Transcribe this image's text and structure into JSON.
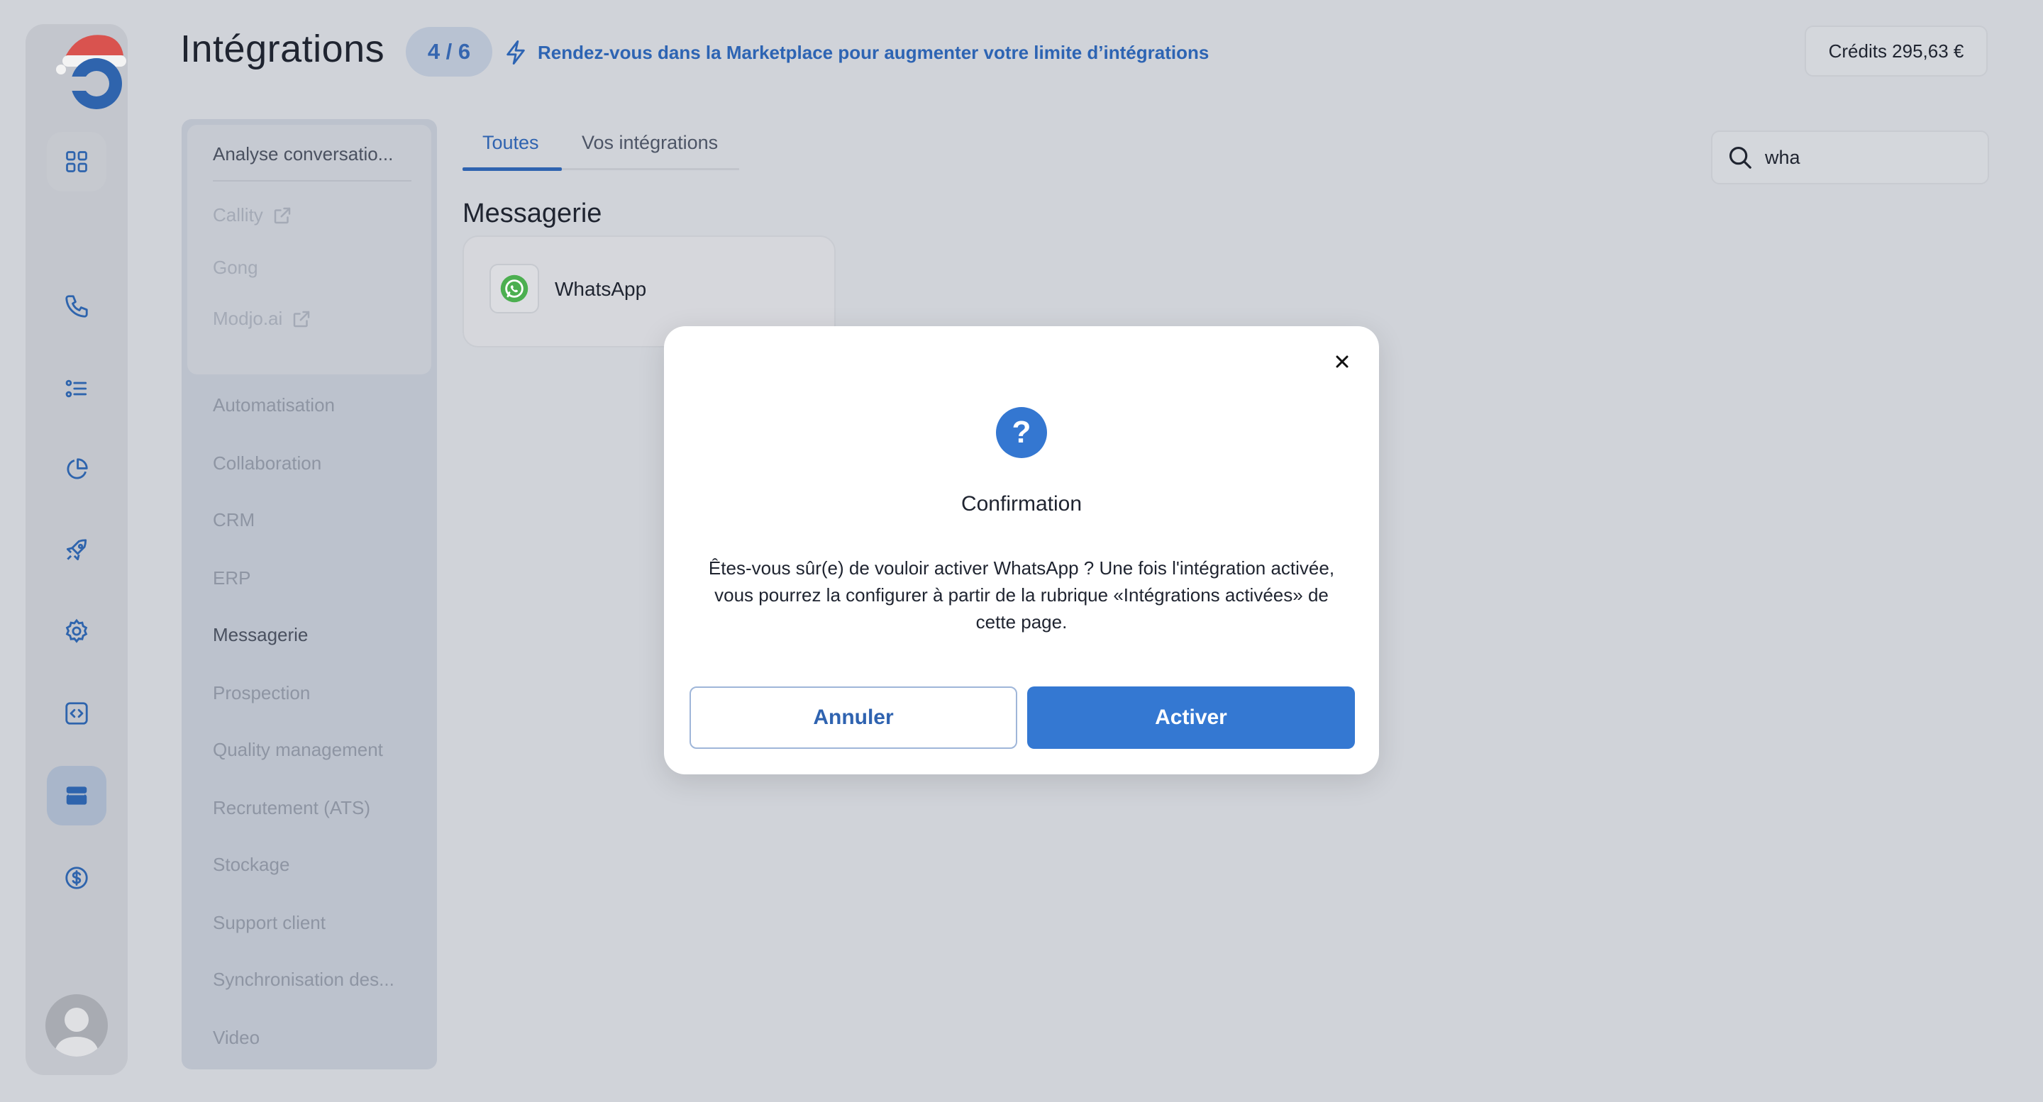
{
  "header": {
    "title": "Intégrations",
    "count_badge": "4 / 6",
    "marketplace_link": "Rendez-vous dans la Marketplace pour augmenter votre limite d’intégrations",
    "credits": "Crédits 295,63 €"
  },
  "rail": {
    "icons": [
      "grid-icon",
      "phone-icon",
      "list-icon",
      "pie-chart-icon",
      "rocket-icon",
      "gear-icon",
      "code-icon",
      "store-icon",
      "dollar-icon"
    ],
    "active": "store-icon"
  },
  "categories": {
    "open_group": {
      "title": "Analyse conversatio...",
      "items": [
        {
          "label": "Callity",
          "external": true
        },
        {
          "label": "Gong",
          "external": false
        },
        {
          "label": "Modjo.ai",
          "external": true
        }
      ]
    },
    "items": [
      "Automatisation",
      "Collaboration",
      "CRM",
      "ERP",
      "Messagerie",
      "Prospection",
      "Quality management",
      "Recrutement (ATS)",
      "Stockage",
      "Support client",
      "Synchronisation des...",
      "Video"
    ],
    "current": "Messagerie"
  },
  "tabs": [
    {
      "label": "Toutes",
      "active": true
    },
    {
      "label": "Vos intégrations",
      "active": false
    }
  ],
  "search": {
    "value": "wha"
  },
  "section": {
    "title": "Messagerie",
    "cards": [
      {
        "name": "WhatsApp",
        "icon": "whatsapp-icon"
      }
    ]
  },
  "modal": {
    "title": "Confirmation",
    "icon": "?",
    "message": "Êtes-vous sûr(e) de vouloir activer WhatsApp ? Une fois l'intégration activée, vous pourrez la configurer à partir de la rubrique «Intégrations activées» de cette page.",
    "cancel_label": "Annuler",
    "confirm_label": "Activer"
  },
  "colors": {
    "accent": "#3478d2",
    "overlay_bg": "#d0d3d9",
    "whatsapp": "#4caf50"
  }
}
